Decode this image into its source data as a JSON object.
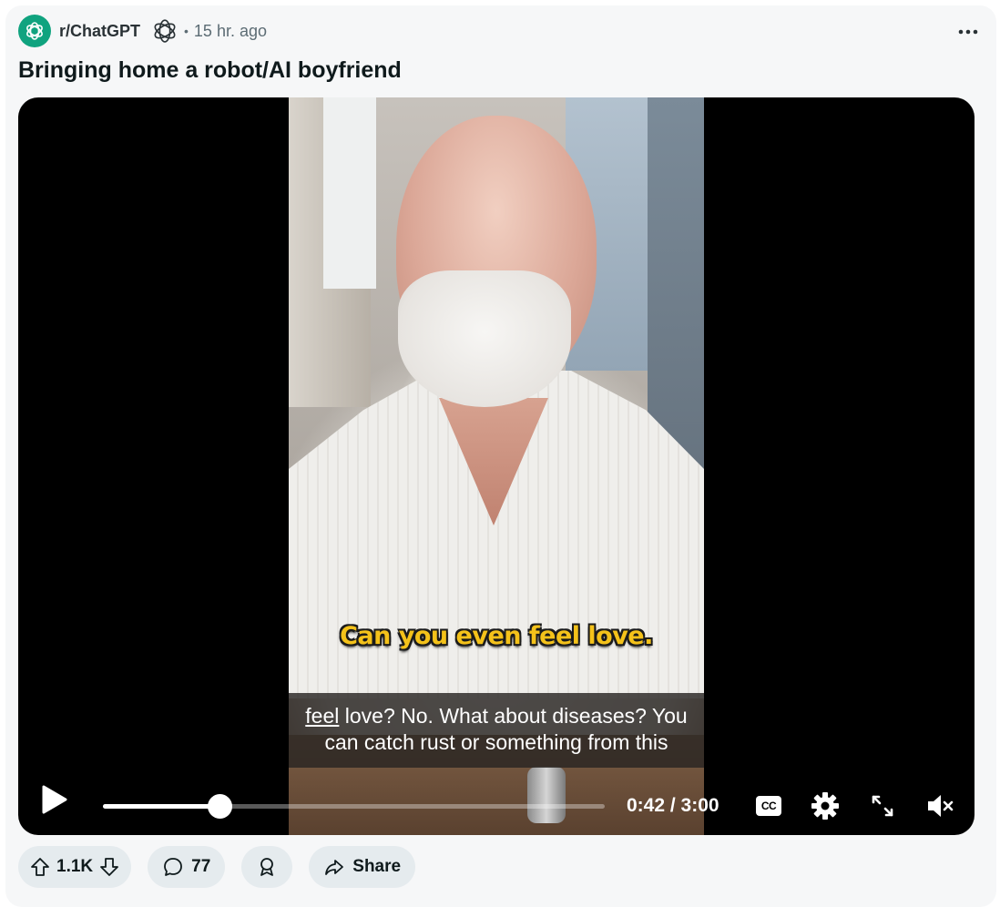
{
  "post": {
    "subreddit": "r/ChatGPT",
    "separator": "•",
    "time_ago": "15 hr. ago",
    "more_label": "•••",
    "title": "Bringing home a robot/AI boyfriend"
  },
  "video": {
    "burned_caption": "Can you even feel love.",
    "closed_caption": {
      "line1_underlined": "feel",
      "line1_rest": " love? No. What about diseases? You",
      "line2": "can catch rust or something from this"
    },
    "current_time": "0:42",
    "duration": "3:00",
    "time_display": "0:42 / 3:00",
    "progress_fraction": 0.233,
    "cc_label": "CC",
    "muted": true
  },
  "actions": {
    "votes": "1.1K",
    "comments": "77",
    "share_label": "Share"
  },
  "colors": {
    "subreddit_avatar": "#10a37f",
    "caption_yellow": "#f4c21a",
    "card_bg": "#f6f7f8",
    "pill_bg": "#e5ebee"
  },
  "icons": [
    "openai-logo-icon",
    "openai-flair-icon",
    "more-icon",
    "play-icon",
    "cc-icon",
    "settings-gear-icon",
    "fullscreen-icon",
    "mute-icon",
    "upvote-icon",
    "downvote-icon",
    "comment-icon",
    "award-icon",
    "share-icon"
  ]
}
